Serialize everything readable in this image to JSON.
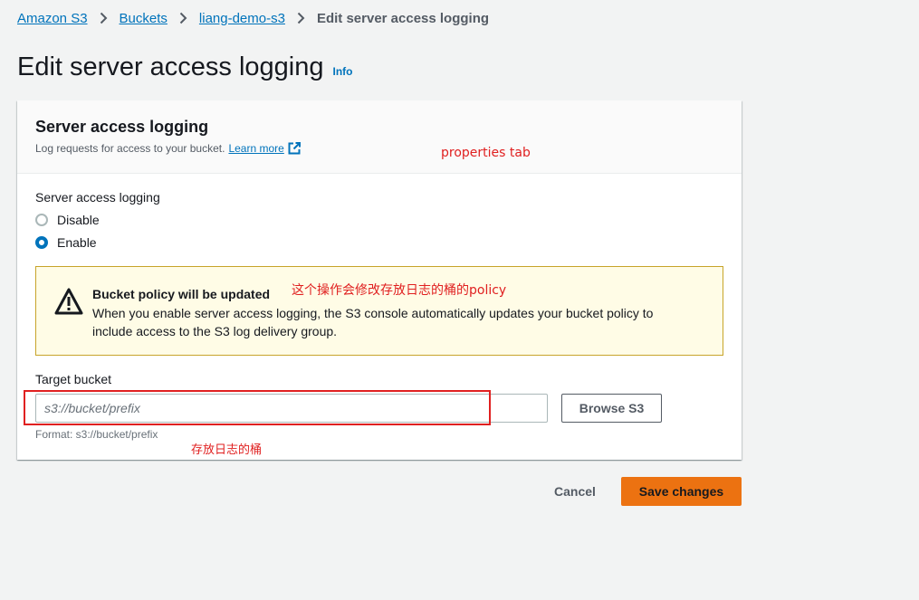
{
  "breadcrumb": {
    "items": [
      "Amazon S3",
      "Buckets",
      "liang-demo-s3"
    ],
    "current": "Edit server access logging"
  },
  "page": {
    "title": "Edit server access logging",
    "info_label": "Info"
  },
  "panel": {
    "title": "Server access logging",
    "description": "Log requests for access to your bucket.",
    "learn_more": "Learn more"
  },
  "logging": {
    "label": "Server access logging",
    "options": [
      "Disable",
      "Enable"
    ],
    "selected": "Enable"
  },
  "alert": {
    "title": "Bucket policy will be updated",
    "text": "When you enable server access logging, the S3 console automatically updates your bucket policy to include access to the S3 log delivery group."
  },
  "target": {
    "label": "Target bucket",
    "placeholder": "s3://bucket/prefix",
    "value": "",
    "browse_label": "Browse S3",
    "hint": "Format: s3://bucket/prefix"
  },
  "actions": {
    "cancel": "Cancel",
    "save": "Save changes"
  },
  "annotations": {
    "properties": "properties tab",
    "policy": "这个操作会修改存放日志的桶的policy",
    "bucket": "存放日志的桶"
  },
  "colors": {
    "link": "#0073bb",
    "primary": "#ec7211",
    "warning_bg": "#fffce6",
    "warning_border": "#c7a42a",
    "annotation": "#e02020"
  }
}
